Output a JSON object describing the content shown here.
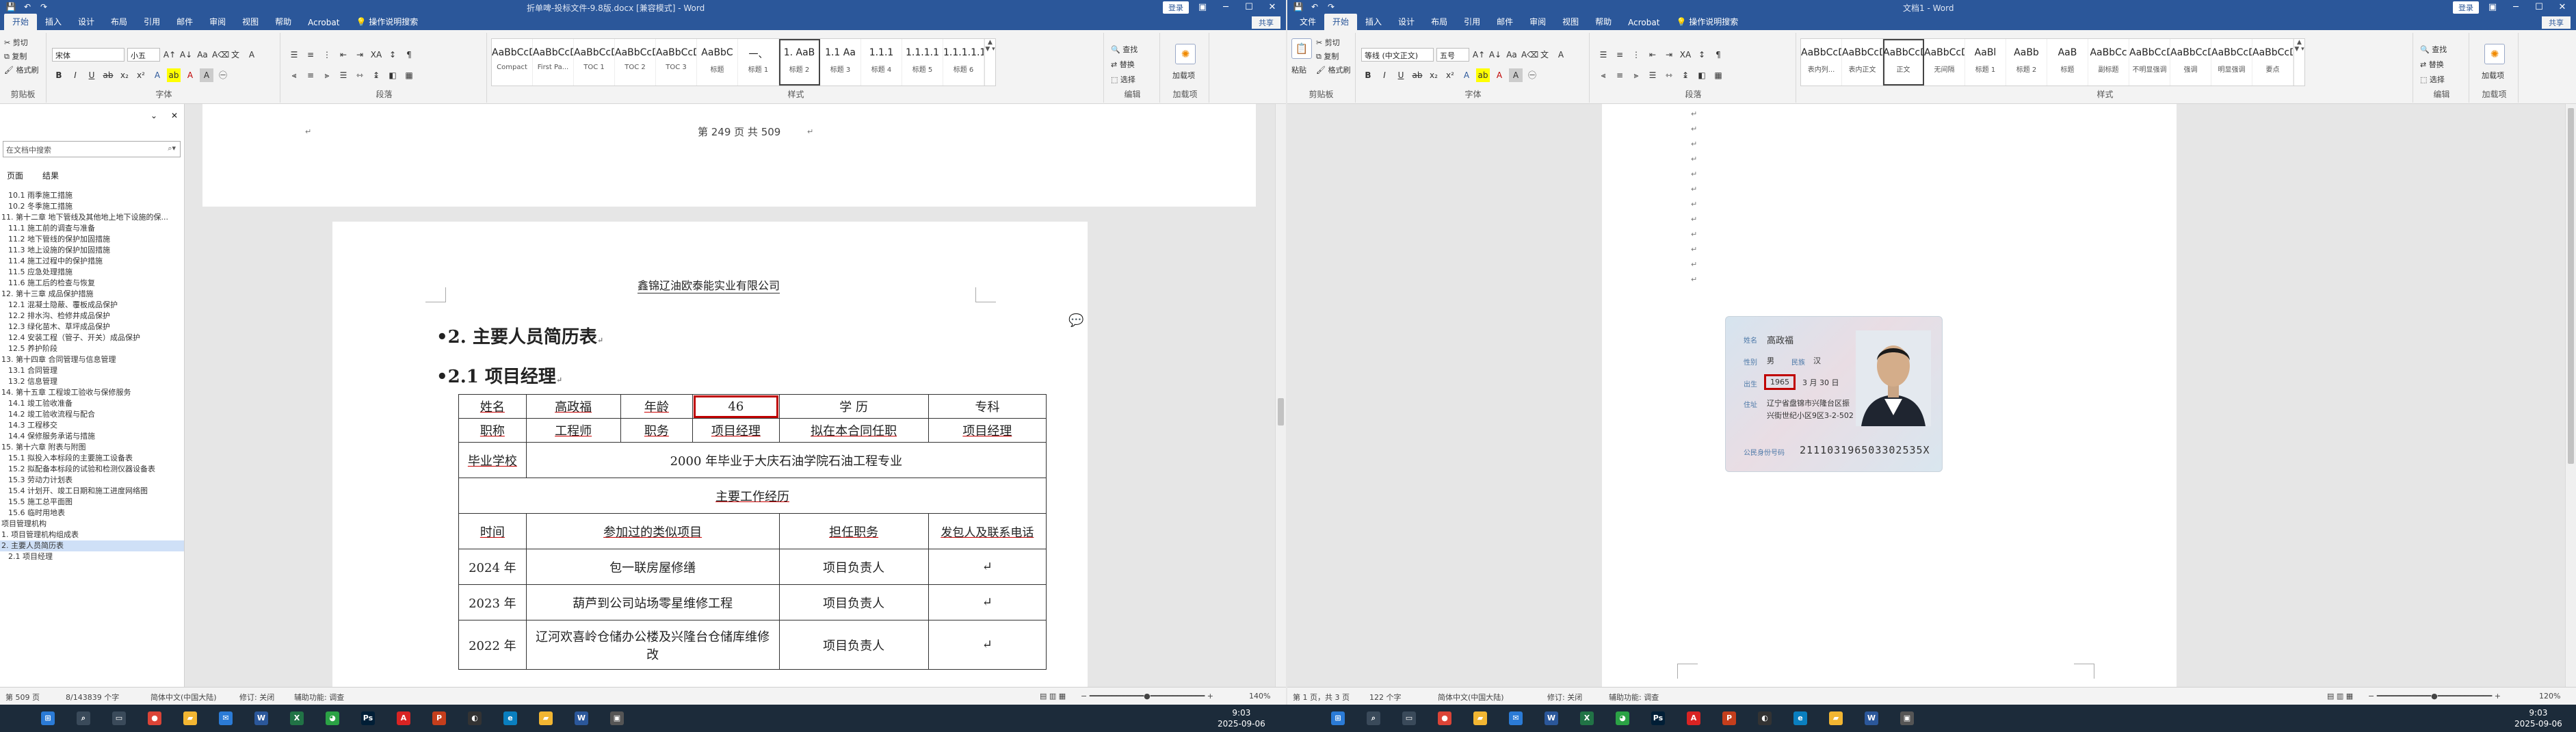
{
  "left_window": {
    "title": "折单啤-投标文件-9.8版.docx [兼容模式] - Word",
    "login": "登录",
    "share": "共享",
    "tabs": [
      "开始",
      "插入",
      "设计",
      "布局",
      "引用",
      "邮件",
      "审阅",
      "视图",
      "帮助",
      "Acrobat",
      "操作说明搜索"
    ],
    "ribbon": {
      "clipboard_label": "剪贴板",
      "cut": "剪切",
      "copy": "复制",
      "format_painter": "格式刷",
      "font_label": "字体",
      "font_name": "宋体",
      "font_size": "小五",
      "paragraph_label": "段落",
      "styles_label": "样式",
      "editing_label": "编辑",
      "find": "查找",
      "replace": "替换",
      "select": "选择",
      "addin_label": "加载项",
      "addin": "加载项",
      "styles": [
        {
          "preview": "AaBbCcDd",
          "name": "Compact"
        },
        {
          "preview": "AaBbCcDc",
          "name": "First Pa..."
        },
        {
          "preview": "AaBbCcDc",
          "name": "TOC 1"
        },
        {
          "preview": "AaBbCcDc",
          "name": "TOC 2"
        },
        {
          "preview": "AaBbCcDc",
          "name": "TOC 3"
        },
        {
          "preview": "AaBbC",
          "name": "标题"
        },
        {
          "preview": "一、",
          "name": "标题 1"
        },
        {
          "preview": "1. AaB",
          "name": "标题 2"
        },
        {
          "preview": "1.1 Aa",
          "name": "标题 3"
        },
        {
          "preview": "1.1.1",
          "name": "标题 4"
        },
        {
          "preview": "1.1.1.1",
          "name": "标题 5"
        },
        {
          "preview": "1.1.1.1.1",
          "name": "标题 6"
        }
      ]
    },
    "nav": {
      "search_placeholder": "在文档中搜索",
      "tabs": [
        "页面",
        "结果"
      ],
      "items": [
        "10.1 雨季施工措施",
        "10.2 冬季施工措施",
        "11. 第十二章 地下管线及其他地上地下设施的保...",
        "11.1 施工前的调查与准备",
        "11.2 地下管线的保护加固措施",
        "11.3 地上设施的保护加固措施",
        "11.4 施工过程中的保护措施",
        "11.5 应急处理措施",
        "11.6 施工后的检查与恢复",
        "12. 第十三章 成品保护措施",
        "12.1 混凝土隐蔽、覆板成品保护",
        "12.2 排水沟、检修井成品保护",
        "12.3 绿化苗木、草坪成品保护",
        "12.4 安装工程（管子、开关）成品保护",
        "12.5 养护阶段",
        "13. 第十四章 合同管理与信息管理",
        "13.1 合同管理",
        "13.2 信息管理",
        "14. 第十五章 工程竣工验收与保修服务",
        "14.1 竣工验收准备",
        "14.2 竣工验收流程与配合",
        "14.3 工程移交",
        "14.4 保修服务承诺与措施",
        "15. 第十六章 附表与附图",
        "15.1 拟投入本标段的主要施工设备表",
        "15.2 拟配备本标段的试验和检测仪器设备表",
        "15.3 劳动力计划表",
        "15.4 计划开、竣工日期和施工进度网络图",
        "15.5 施工总平面图",
        "15.6 临时用地表",
        "项目管理机构",
        "1. 项目管理机构组成表",
        "2. 主要人员简历表",
        "2.1 项目经理"
      ],
      "selected_index": 32
    },
    "page_footer": "第 249 页 共 509",
    "header_company": "鑫锦辽油欧泰能实业有限公司",
    "heading_main": "2.  主要人员简历表",
    "heading_sub": "2.1   项目经理",
    "table": {
      "r1": [
        "姓名",
        "高政福",
        "年龄",
        "46",
        "学      历",
        "专科"
      ],
      "r2": [
        "职称",
        "工程师",
        "职务",
        "项目经理",
        "拟在本合同任职",
        "项目经理"
      ],
      "r3": [
        "毕业学校",
        "2000 年毕业于大庆石油学院石油工程专业"
      ],
      "r4": "主要工作经历",
      "r5": [
        "时间",
        "参加过的类似项目",
        "担任职务",
        "发包人及联系电话"
      ],
      "rows": [
        [
          "2024 年",
          "包一联房屋修缮",
          "项目负责人"
        ],
        [
          "2023 年",
          "葫芦到公司站场零星维修工程",
          "项目负责人"
        ],
        [
          "2022 年",
          "辽河欢喜岭仓储办公楼及兴隆台仓储库维修改",
          "项目负责人"
        ]
      ]
    },
    "status": {
      "page": "第 509 页",
      "words": "8/143839 个字",
      "lang": "简体中文(中国大陆)",
      "track": "修订: 关闭",
      "access": "辅助功能: 调查",
      "zoom": "140%"
    }
  },
  "right_window": {
    "title": "文档1 - Word",
    "login": "登录",
    "share": "共享",
    "tabs": [
      "文件",
      "开始",
      "插入",
      "设计",
      "布局",
      "引用",
      "邮件",
      "审阅",
      "视图",
      "帮助",
      "Acrobat",
      "操作说明搜索"
    ],
    "ribbon": {
      "clipboard_label": "剪贴板",
      "paste": "粘贴",
      "cut": "剪切",
      "copy": "复制",
      "format_painter": "格式刷",
      "font_label": "字体",
      "font_name": "等线 (中文正文)",
      "font_size": "五号",
      "paragraph_label": "段落",
      "styles_label": "样式",
      "editing_label": "编辑",
      "find": "查找",
      "replace": "替换",
      "select": "选择",
      "addin_label": "加载项",
      "addin": "加载项",
      "styles": [
        {
          "preview": "AaBbCcDc",
          "name": "表内列..."
        },
        {
          "preview": "AaBbCcDc",
          "name": "表内正文"
        },
        {
          "preview": "AaBbCcDc",
          "name": "正文"
        },
        {
          "preview": "AaBbCcDc",
          "name": "无间隔"
        },
        {
          "preview": "AaBl",
          "name": "标题 1"
        },
        {
          "preview": "AaBb",
          "name": "标题 2"
        },
        {
          "preview": "AaB",
          "name": "标题"
        },
        {
          "preview": "AaBbCc",
          "name": "副标题"
        },
        {
          "preview": "AaBbCcDc",
          "name": "不明显强调"
        },
        {
          "preview": "AaBbCcDc",
          "name": "强调"
        },
        {
          "preview": "AaBbCcDc",
          "name": "明显强调"
        },
        {
          "preview": "AaBbCcDc",
          "name": "要点"
        }
      ]
    },
    "idcard": {
      "name_label": "姓名",
      "name": "高政福",
      "sex_label": "性别",
      "sex": "男",
      "ethnic_label": "民族",
      "ethnic": "汉",
      "birth_label": "出生",
      "birth_year": "1965",
      "birth_rest": "3  月  30  日",
      "addr_label": "住址",
      "addr1": "辽宁省盘锦市兴隆台区振",
      "addr2": "兴街世纪小区9区3-2-502",
      "id_label": "公民身份号码",
      "id_number": "211103196503302535X"
    },
    "status": {
      "page": "第 1 页，共 3 页",
      "words": "122 个字",
      "lang": "简体中文(中国大陆)",
      "track": "修订: 关闭",
      "access": "辅助功能: 调查",
      "zoom": "120%"
    }
  },
  "taskbar": {
    "time_left": "9:03",
    "date_left": "2025-09-06",
    "time_right": "9:03",
    "date_right": "2025-09-06"
  },
  "colors": {
    "word_blue": "#2b579a",
    "highlight_red": "#c00000"
  }
}
